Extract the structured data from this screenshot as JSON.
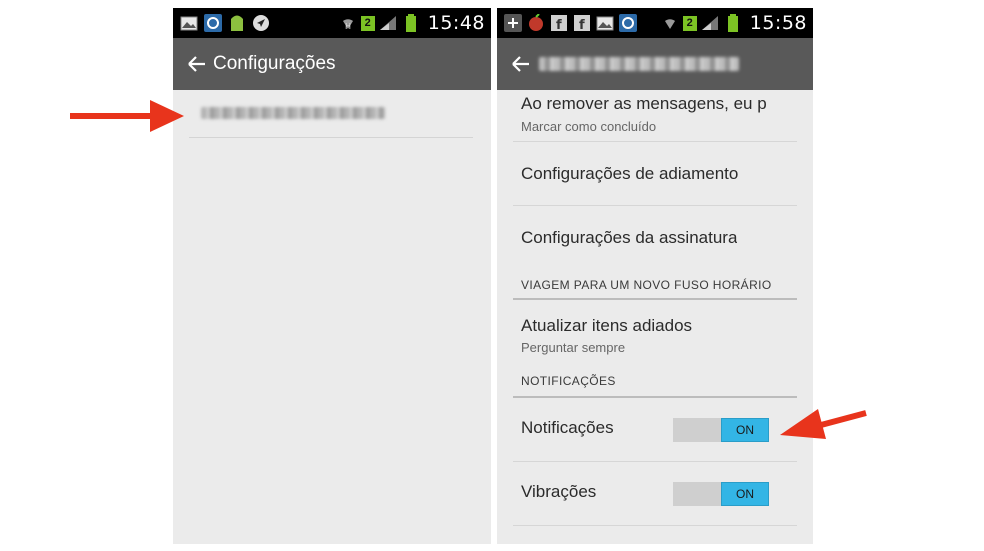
{
  "left_screen": {
    "status_time": "15:48",
    "signal_badge": "2",
    "title": "Configurações",
    "account_label": ""
  },
  "right_screen": {
    "status_time": "15:58",
    "signal_badge": "2",
    "title": "",
    "items": [
      {
        "title": "Ao remover as mensagens, eu p",
        "subtitle": "Marcar como concluído"
      },
      {
        "title": "Configurações de adiamento"
      },
      {
        "title": "Configurações da assinatura"
      }
    ],
    "section_travel": "VIAGEM PARA UM NOVO FUSO HORÁRIO",
    "travel_item": {
      "title": "Atualizar itens adiados",
      "subtitle": "Perguntar sempre"
    },
    "section_notifications": "NOTIFICAÇÕES",
    "notification_item": {
      "title": "Notificações",
      "toggle": "ON"
    },
    "vibration_item": {
      "title": "Vibrações",
      "toggle": "ON"
    }
  },
  "icons": [
    "gallery-icon",
    "sync-icon",
    "android-icon",
    "navigation-icon",
    "wifi-icon",
    "signal-icon",
    "battery-icon",
    "back-arrow-icon",
    "red-arrow-icon",
    "facebook-icon"
  ],
  "colors": {
    "accent": "#33b5e5",
    "action_bar": "#595959",
    "arrow": "#e8341c"
  }
}
